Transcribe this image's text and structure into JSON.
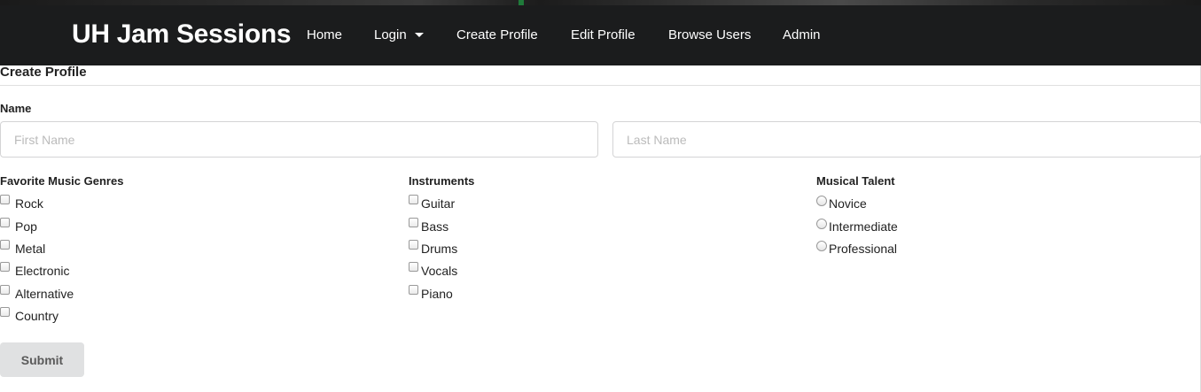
{
  "nav": {
    "brand": "UH Jam Sessions",
    "items": [
      {
        "label": "Home"
      },
      {
        "label": "Login"
      },
      {
        "label": "Create Profile"
      },
      {
        "label": "Edit Profile"
      },
      {
        "label": "Browse Users"
      },
      {
        "label": "Admin"
      }
    ]
  },
  "form": {
    "title": "Create Profile",
    "name_label": "Name",
    "first_name_placeholder": "First Name",
    "last_name_placeholder": "Last Name",
    "genres": {
      "label": "Favorite Music Genres",
      "options": [
        "Rock",
        "Pop",
        "Metal",
        "Electronic",
        "Alternative",
        "Country"
      ]
    },
    "instruments": {
      "label": "Instruments",
      "options": [
        "Guitar",
        "Bass",
        "Drums",
        "Vocals",
        "Piano"
      ]
    },
    "talent": {
      "label": "Musical Talent",
      "options": [
        "Novice",
        "Intermediate",
        "Professional"
      ]
    },
    "submit_label": "Submit"
  }
}
